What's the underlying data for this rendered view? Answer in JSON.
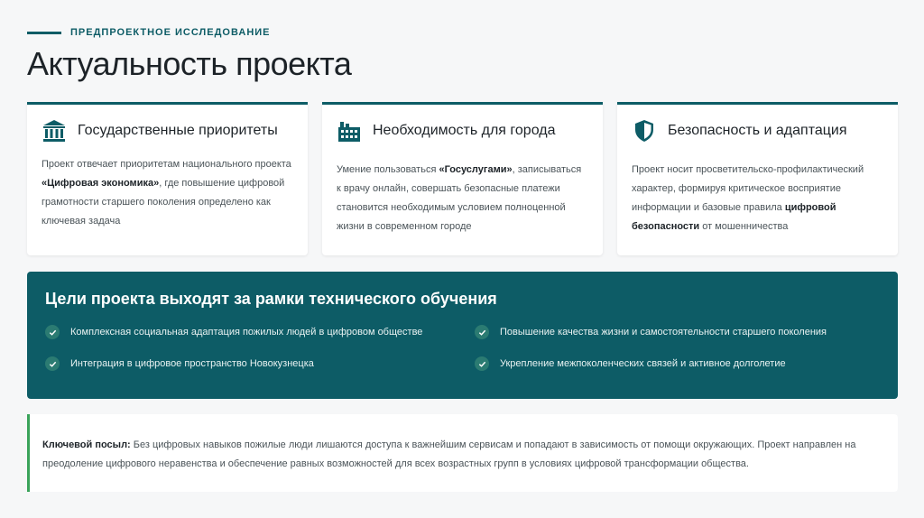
{
  "header": {
    "kicker": "ПРЕДПРОЕКТНОЕ ИССЛЕДОВАНИЕ",
    "title": "Актуальность проекта"
  },
  "cards": [
    {
      "icon": "landmark-icon",
      "title": "Государственные приоритеты",
      "text_before": "Проект отвечает приоритетам национального проекта ",
      "text_bold": "«Цифровая экономика»",
      "text_after": ", где повышение цифровой грамотности старшего поколения определено как ключевая задача"
    },
    {
      "icon": "city-icon",
      "title": "Необходимость для города",
      "text_before": "Умение пользоваться ",
      "text_bold": "«Госуслугами»",
      "text_after": ", записываться к врачу онлайн, совершать безопасные платежи становится необходимым условием полноценной жизни в современном городе"
    },
    {
      "icon": "shield-icon",
      "title": "Безопасность и адаптация",
      "text_before": "Проект носит просветительско-профилактический характер, формируя критическое восприятие информации и базовые правила ",
      "text_bold": "цифровой безопасности",
      "text_after": " от мошенничества"
    }
  ],
  "goals": {
    "title": "Цели проекта выходят за рамки технического обучения",
    "items": [
      "Комплексная социальная адаптация пожилых людей в цифровом обществе",
      "Повышение качества жизни и самостоятельности старшего поколения",
      "Интеграция в цифровое пространство Новокузнецка",
      "Укрепление межпоколенческих связей и активное долголетие"
    ]
  },
  "message": {
    "label": "Ключевой посыл:",
    "text": " Без цифровых навыков пожилые люди лишаются доступа к важнейшим сервисам и попадают в зависимость от помощи окружающих. Проект направлен на преодоление цифрового неравенства и обеспечение равных возможностей для всех возрастных групп в условиях цифровой трансформации общества."
  },
  "colors": {
    "accent": "#0d5c66",
    "message_border": "#3aa35a",
    "background": "#f6f7f8"
  }
}
